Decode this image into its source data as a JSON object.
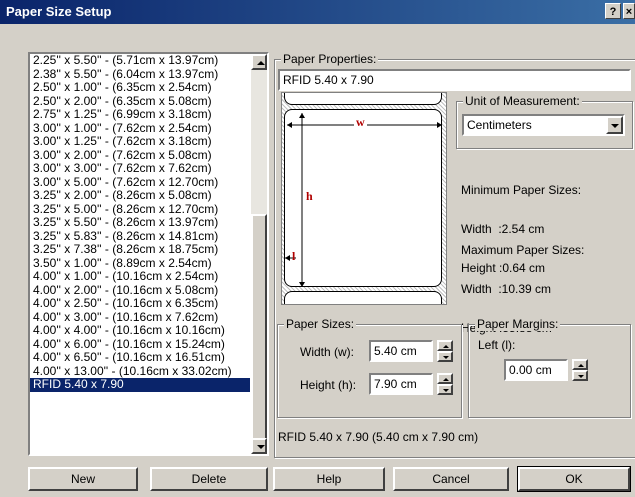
{
  "window": {
    "title": "Paper Size Setup",
    "help_btn": "?",
    "close_btn": "×"
  },
  "paper_list": {
    "items": [
      "2.25'' x 5.50'' - (5.71cm x 13.97cm)",
      "2.38'' x 5.50'' - (6.04cm x 13.97cm)",
      "2.50'' x 1.00'' - (6.35cm x 2.54cm)",
      "2.50'' x 2.00'' - (6.35cm x 5.08cm)",
      "2.75'' x 1.25'' - (6.99cm x 3.18cm)",
      "3.00'' x 1.00'' - (7.62cm x 2.54cm)",
      "3.00'' x 1.25'' - (7.62cm x 3.18cm)",
      "3.00'' x 2.00'' - (7.62cm x 5.08cm)",
      "3.00'' x 3.00'' - (7.62cm x 7.62cm)",
      "3.00'' x 5.00'' - (7.62cm x 12.70cm)",
      "3.25'' x 2.00'' - (8.26cm x 5.08cm)",
      "3.25'' x 5.00'' - (8.26cm x 12.70cm)",
      "3.25'' x 5.50'' - (8.26cm x 13.97cm)",
      "3.25'' x 5.83'' - (8.26cm x 14.81cm)",
      "3.25'' x 7.38'' - (8.26cm x 18.75cm)",
      "3.50'' x 1.00'' - (8.89cm x 2.54cm)",
      "4.00'' x 1.00'' - (10.16cm x 2.54cm)",
      "4.00'' x 2.00'' - (10.16cm x 5.08cm)",
      "4.00'' x 2.50'' - (10.16cm x 6.35cm)",
      "4.00'' x 3.00'' - (10.16cm x 7.62cm)",
      "4.00'' x 4.00'' - (10.16cm x 10.16cm)",
      "4.00'' x 6.00'' - (10.16cm x 15.24cm)",
      "4.00'' x 6.50'' - (10.16cm x 16.51cm)",
      "4.00'' x 13.00'' - (10.16cm x 33.02cm)",
      "RFID 5.40 x 7.90"
    ],
    "selected_index": 24
  },
  "paper_properties": {
    "label": "Paper Properties:",
    "name_value": "RFID 5.40 x 7.90",
    "diagram": {
      "w": "w",
      "h": "h",
      "l": "l"
    }
  },
  "unit": {
    "label": "Unit of Measurement:",
    "value": "Centimeters"
  },
  "min_sizes": {
    "title": "Minimum Paper Sizes:",
    "width": "Width  :2.54 cm",
    "height": "Height :0.64 cm"
  },
  "max_sizes": {
    "title": "Maximum Paper Sizes:",
    "width": "Width  :10.39 cm",
    "height": "Height :55.88 cm"
  },
  "paper_sizes": {
    "label": "Paper Sizes:",
    "width_label": "Width (w):",
    "width_value": "5.40 cm",
    "height_label": "Height (h):",
    "height_value": "7.90 cm"
  },
  "paper_margins": {
    "label": "Paper Margins:",
    "left_label": "Left (l):",
    "left_value": "0.00 cm"
  },
  "summary": "RFID 5.40 x 7.90 (5.40 cm x 7.90 cm)",
  "buttons": {
    "new": "New",
    "delete": "Delete",
    "help": "Help",
    "cancel": "Cancel",
    "ok": "OK"
  }
}
